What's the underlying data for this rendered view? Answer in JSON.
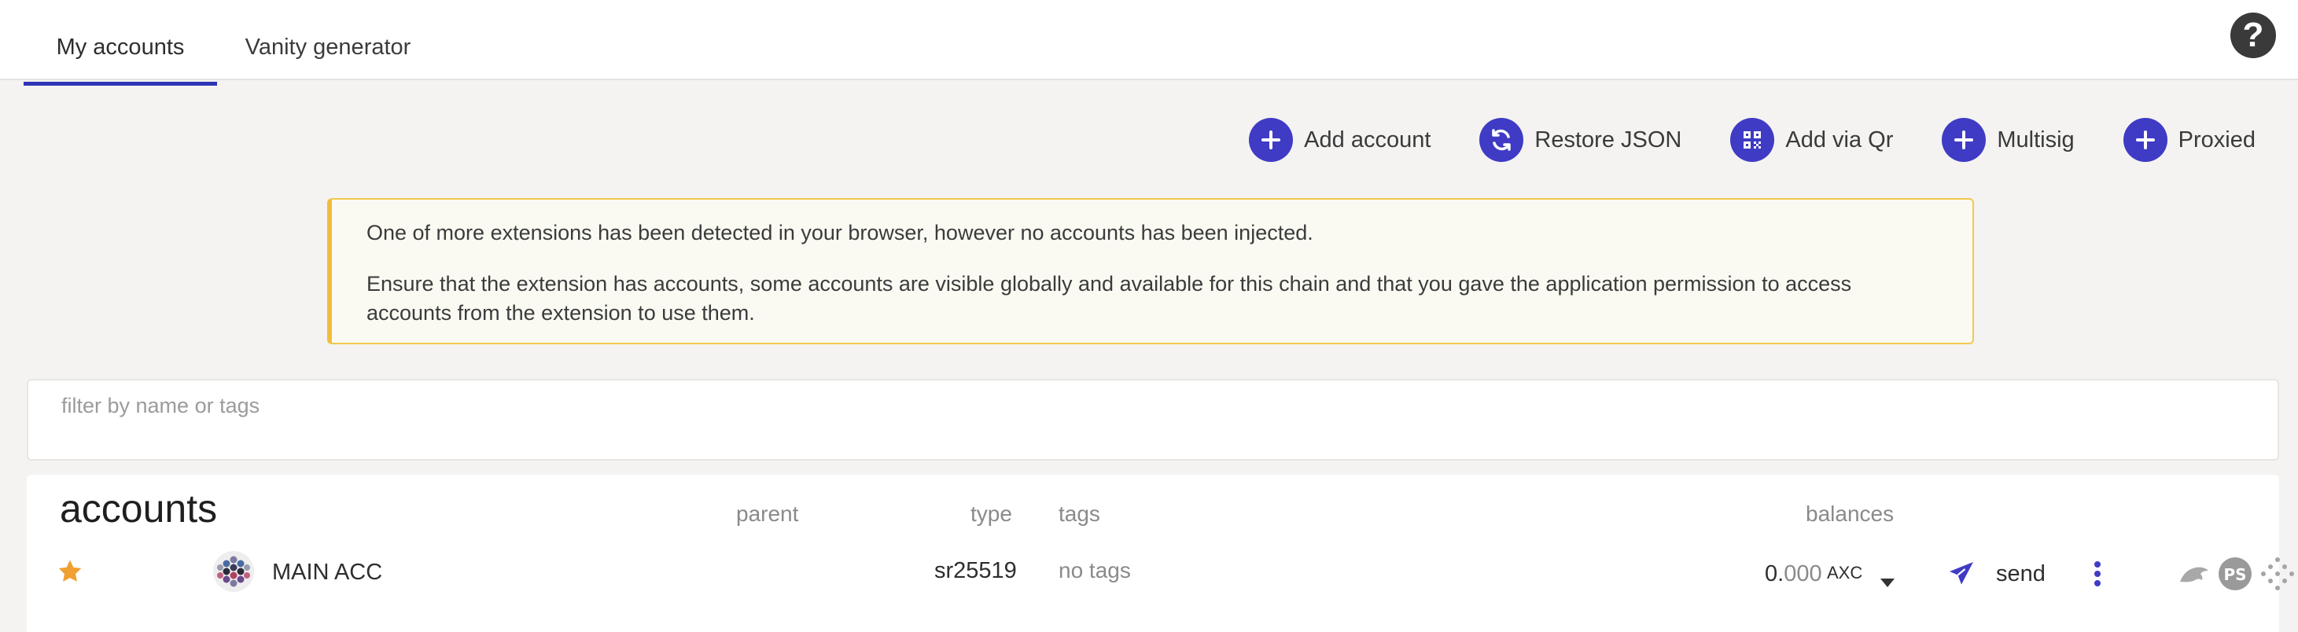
{
  "tabs": [
    {
      "label": "My accounts",
      "active": true
    },
    {
      "label": "Vanity generator",
      "active": false
    }
  ],
  "help_icon": "question-circle-icon",
  "actions": [
    {
      "label": "Add account",
      "icon": "plus-icon"
    },
    {
      "label": "Restore JSON",
      "icon": "sync-icon"
    },
    {
      "label": "Add via Qr",
      "icon": "qrcode-icon"
    },
    {
      "label": "Multisig",
      "icon": "plus-icon"
    },
    {
      "label": "Proxied",
      "icon": "plus-icon"
    }
  ],
  "warning": {
    "line1": "One of more extensions has been detected in your browser, however no accounts has been injected.",
    "line2": "Ensure that the extension has accounts, some accounts are visible globally and available for this chain and that you gave the application permission to access accounts from the extension to use them."
  },
  "filter": {
    "placeholder": "filter by name or tags",
    "value": ""
  },
  "accounts_table": {
    "title": "accounts",
    "headers": {
      "parent": "parent",
      "type": "type",
      "tags": "tags",
      "balances": "balances"
    },
    "rows": [
      {
        "favorite": true,
        "name": "MAIN ACC",
        "type": "sr25519",
        "tags": "no tags",
        "balance_int": "0.",
        "balance_dec": "000",
        "balance_unit": "AXC",
        "send_label": "send"
      }
    ]
  },
  "colors": {
    "accent": "#3f3bc4",
    "star": "#f0a030",
    "warning_border": "#f3bc3c",
    "tab_underline": "#2e35b5"
  }
}
